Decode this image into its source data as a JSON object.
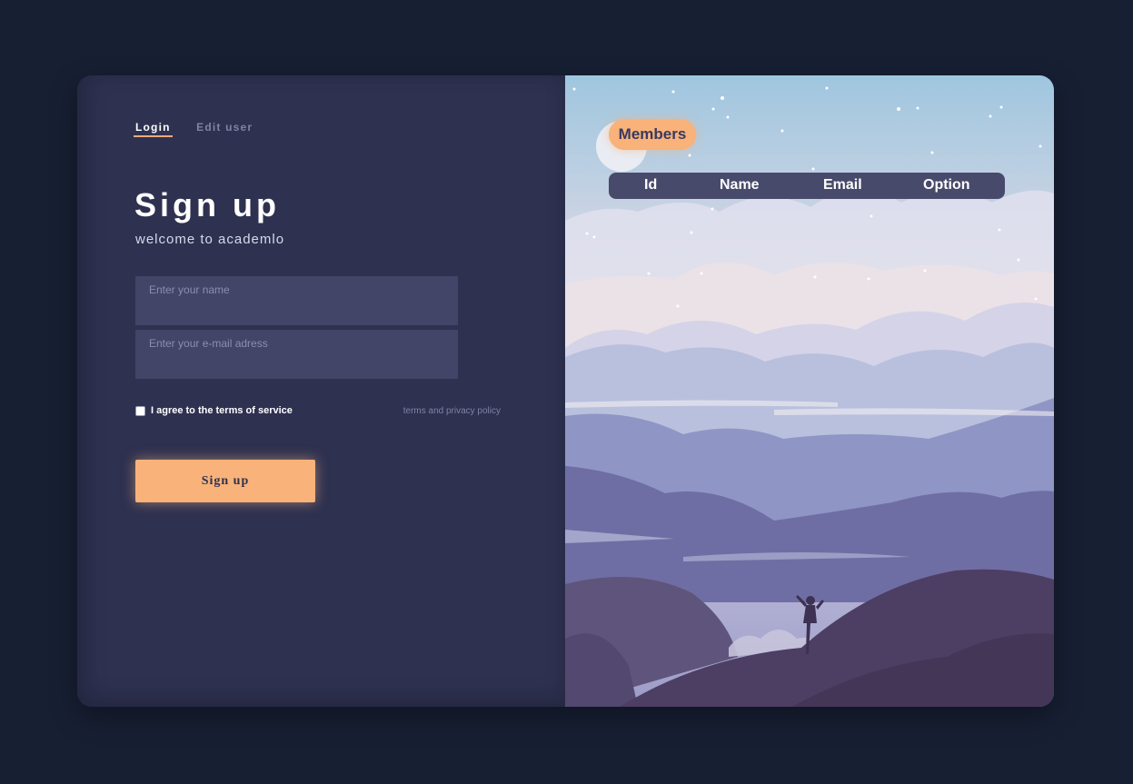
{
  "nav": {
    "login_label": "Login",
    "edit_user_label": "Edit user"
  },
  "form": {
    "title": "Sign up",
    "subtitle": "welcome to academlo",
    "name_placeholder": "Enter your name",
    "email_placeholder": "Enter your e-mail adress",
    "terms_label": "I agree to the terms of service",
    "terms_link": "terms and privacy policy",
    "submit_label": "Sign up"
  },
  "members": {
    "button_label": "Members",
    "columns": [
      "Id",
      "Name",
      "Email",
      "Option"
    ]
  },
  "colors": {
    "accent": "#f8b27a",
    "panel": "#2e3150",
    "background": "#171f33"
  }
}
